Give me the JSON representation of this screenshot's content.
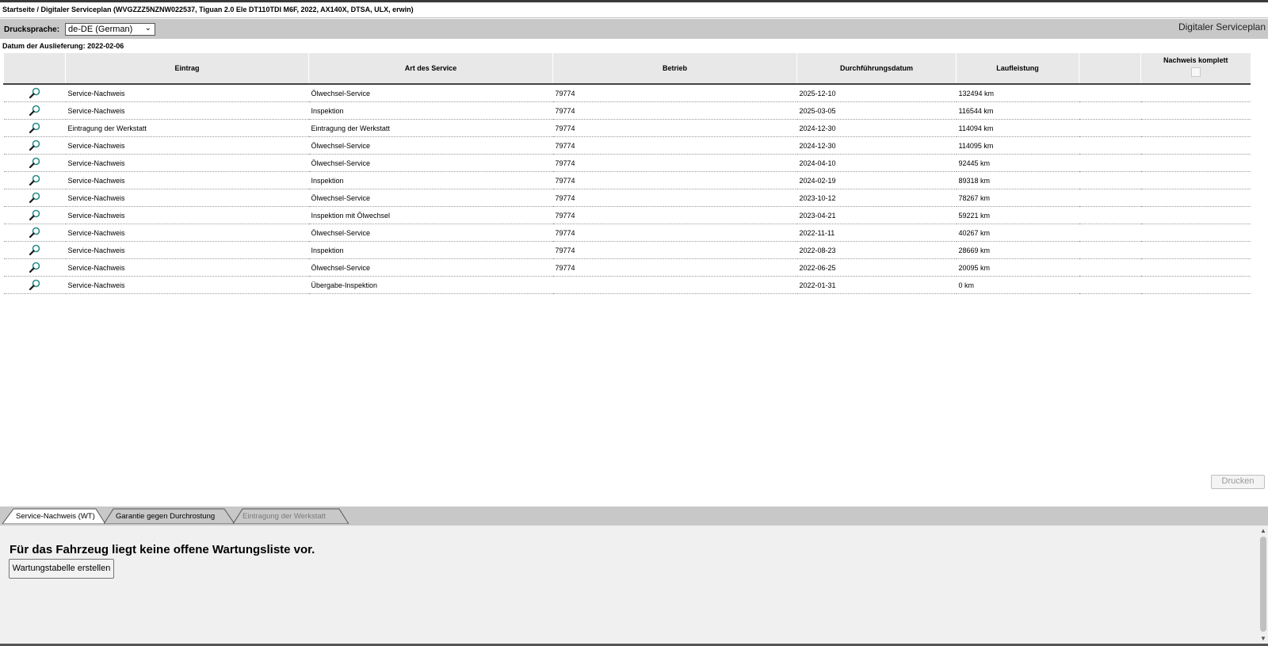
{
  "breadcrumb": "Startseite / Digitaler Serviceplan (WVGZZZ5NZNW022537, Tiguan 2.0 Ele DT110TDI M6F, 2022, AX140X, DTSA, ULX, erwin)",
  "toolbar": {
    "print_language_label": "Drucksprache:",
    "language_value": "de-DE (German)",
    "app_title": "Digitaler Serviceplan"
  },
  "delivery_date": "Datum der Auslieferung: 2022-02-06",
  "table": {
    "headers": [
      "",
      "Eintrag",
      "Art des Service",
      "Betrieb",
      "Durchführungsdatum",
      "Laufleistung",
      "",
      "Nachweis komplett"
    ],
    "rows": [
      {
        "eintrag": "Service-Nachweis",
        "art": "Ölwechsel-Service",
        "betrieb": "79774",
        "datum": "2025-12-10",
        "laufleistung": "132494 km"
      },
      {
        "eintrag": "Service-Nachweis",
        "art": "Inspektion",
        "betrieb": "79774",
        "datum": "2025-03-05",
        "laufleistung": "116544 km"
      },
      {
        "eintrag": "Eintragung der Werkstatt",
        "art": "Eintragung der Werkstatt",
        "betrieb": "79774",
        "datum": "2024-12-30",
        "laufleistung": "114094 km"
      },
      {
        "eintrag": "Service-Nachweis",
        "art": "Ölwechsel-Service",
        "betrieb": "79774",
        "datum": "2024-12-30",
        "laufleistung": "114095 km"
      },
      {
        "eintrag": "Service-Nachweis",
        "art": "Ölwechsel-Service",
        "betrieb": "79774",
        "datum": "2024-04-10",
        "laufleistung": "92445 km"
      },
      {
        "eintrag": "Service-Nachweis",
        "art": "Inspektion",
        "betrieb": "79774",
        "datum": "2024-02-19",
        "laufleistung": "89318 km"
      },
      {
        "eintrag": "Service-Nachweis",
        "art": "Ölwechsel-Service",
        "betrieb": "79774",
        "datum": "2023-10-12",
        "laufleistung": "78267 km"
      },
      {
        "eintrag": "Service-Nachweis",
        "art": "Inspektion mit Ölwechsel",
        "betrieb": "79774",
        "datum": "2023-04-21",
        "laufleistung": "59221 km"
      },
      {
        "eintrag": "Service-Nachweis",
        "art": "Ölwechsel-Service",
        "betrieb": "79774",
        "datum": "2022-11-11",
        "laufleistung": "40267 km"
      },
      {
        "eintrag": "Service-Nachweis",
        "art": "Inspektion",
        "betrieb": "79774",
        "datum": "2022-08-23",
        "laufleistung": "28669 km"
      },
      {
        "eintrag": "Service-Nachweis",
        "art": "Ölwechsel-Service",
        "betrieb": "79774",
        "datum": "2022-06-25",
        "laufleistung": "20095 km"
      },
      {
        "eintrag": "Service-Nachweis",
        "art": "Übergabe-Inspektion",
        "betrieb": "",
        "datum": "2022-01-31",
        "laufleistung": "0 km"
      }
    ]
  },
  "print_button": "Drucken",
  "tabs": [
    {
      "label": "Service-Nachweis (WT)"
    },
    {
      "label": "Garantie gegen Durchrostung"
    },
    {
      "label": "Eintragung der Werkstatt"
    }
  ],
  "panel": {
    "message": "Für das Fahrzeug liegt keine offene Wartungsliste vor.",
    "button": "Wartungstabelle erstellen"
  },
  "icons": {
    "row_icon": "magnifier-icon"
  },
  "colors": {
    "toolbar_bg": "#c8c8c8",
    "header_bg": "#e8e8e8",
    "panel_bg": "#f0f0f0",
    "icon_color": "#2a8a8a"
  }
}
